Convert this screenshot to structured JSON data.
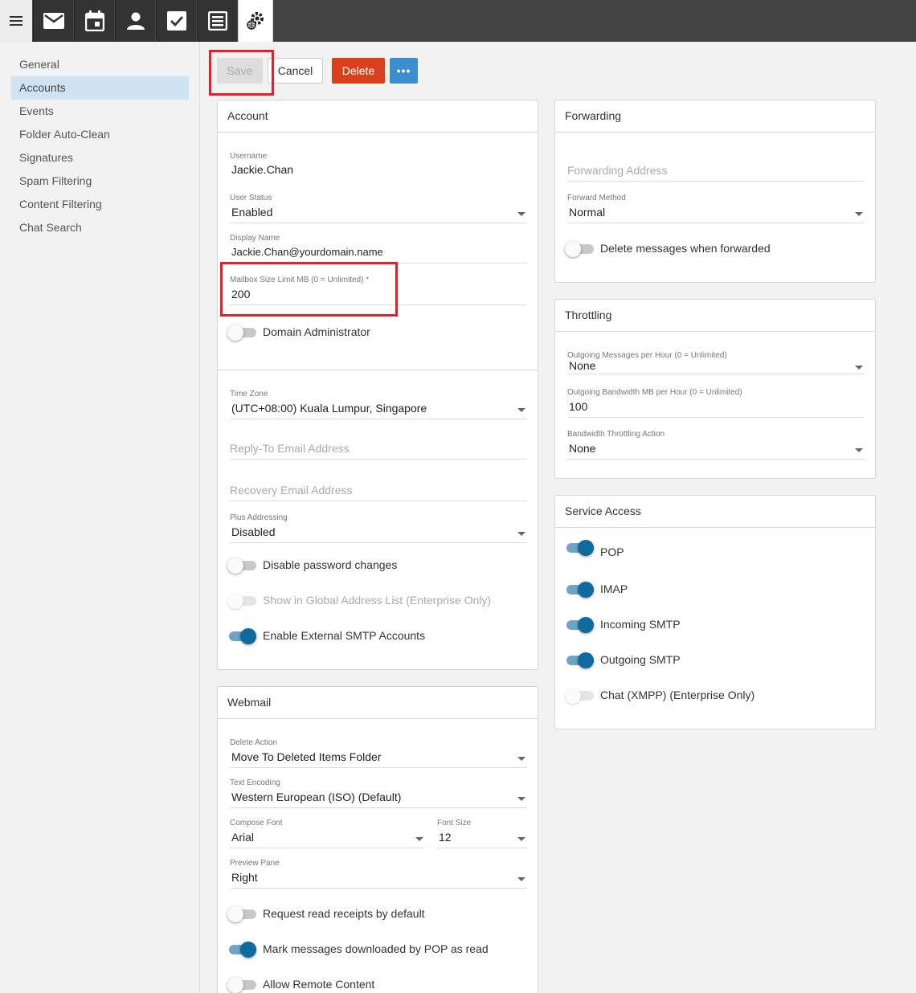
{
  "topbar": {
    "tabs": [
      "mail-icon",
      "calendar-icon",
      "contacts-icon",
      "tasks-icon",
      "notes-icon",
      "settings-icon"
    ]
  },
  "sidebar": {
    "items": [
      {
        "label": "General"
      },
      {
        "label": "Accounts"
      },
      {
        "label": "Events"
      },
      {
        "label": "Folder Auto-Clean"
      },
      {
        "label": "Signatures"
      },
      {
        "label": "Spam Filtering"
      },
      {
        "label": "Content Filtering"
      },
      {
        "label": "Chat Search"
      }
    ],
    "active": "Accounts"
  },
  "toolbar": {
    "save_label": "Save",
    "cancel_label": "Cancel",
    "delete_label": "Delete",
    "more_label": "•••"
  },
  "account": {
    "title": "Account",
    "username_label": "Username",
    "username": "Jackie.Chan",
    "user_status_label": "User Status",
    "user_status": "Enabled",
    "display_name_label": "Display Name",
    "display_name": "Jackie.Chan@yourdomain.name",
    "mailbox_label": "Mailbox Size Limit MB (0 = Unlimited) *",
    "mailbox_value": "200",
    "domain_admin_label": "Domain Administrator",
    "time_zone_label": "Time Zone",
    "time_zone": "(UTC+08:00) Kuala Lumpur, Singapore",
    "reply_to_placeholder": "Reply-To Email Address",
    "recovery_placeholder": "Recovery Email Address",
    "plus_addressing_label": "Plus Addressing",
    "plus_addressing": "Disabled",
    "disable_pw_label": "Disable password changes",
    "show_gal_label": "Show in Global Address List (Enterprise Only)",
    "ext_smtp_label": "Enable External SMTP Accounts"
  },
  "webmail": {
    "title": "Webmail",
    "delete_action_label": "Delete Action",
    "delete_action": "Move To Deleted Items Folder",
    "text_encoding_label": "Text Encoding",
    "text_encoding": "Western European (ISO) (Default)",
    "compose_font_label": "Compose Font",
    "compose_font": "Arial",
    "font_size_label": "Font Size",
    "font_size": "12",
    "preview_pane_label": "Preview Pane",
    "preview_pane": "Right",
    "read_receipts_label": "Request read receipts by default",
    "mark_pop_label": "Mark messages downloaded by POP as read",
    "remote_content_label": "Allow Remote Content"
  },
  "forwarding": {
    "title": "Forwarding",
    "address_placeholder": "Forwarding Address",
    "method_label": "Forward Method",
    "method": "Normal",
    "delete_label": "Delete messages when forwarded"
  },
  "throttling": {
    "title": "Throttling",
    "out_msgs_label": "Outgoing Messages per Hour (0 = Unlimited)",
    "out_msgs": "None",
    "out_bw_label": "Outgoing Bandwidth MB per Hour (0 = Unlimited)",
    "out_bw": "100",
    "bw_action_label": "Bandwidth Throttling Action",
    "bw_action": "None"
  },
  "service_access": {
    "title": "Service Access",
    "pop_label": "POP",
    "imap_label": "IMAP",
    "incoming_label": "Incoming SMTP",
    "outgoing_label": "Outgoing SMTP",
    "chat_label": "Chat (XMPP) (Enterprise Only)"
  },
  "colors": {
    "delete_button": "#d9411e",
    "more_button": "#3b8ed0",
    "highlight": "#e3202c",
    "toggle_on": "#0f6aa0"
  }
}
